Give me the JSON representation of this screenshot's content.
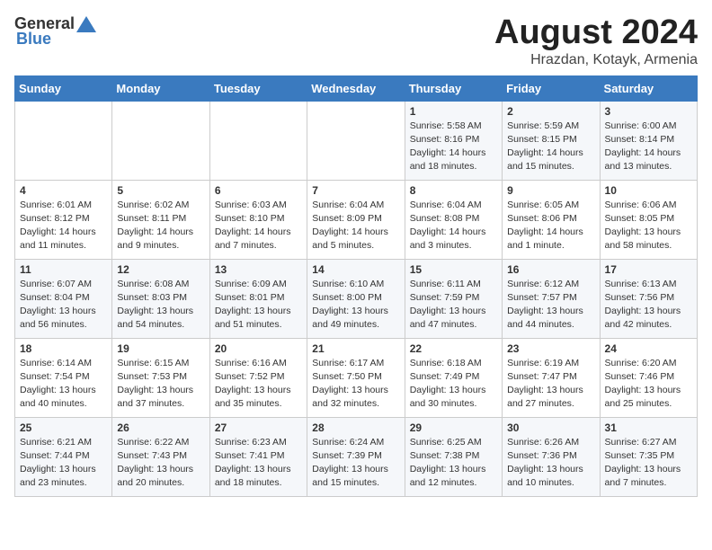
{
  "header": {
    "logo_general": "General",
    "logo_blue": "Blue",
    "month_year": "August 2024",
    "location": "Hrazdan, Kotayk, Armenia"
  },
  "weekdays": [
    "Sunday",
    "Monday",
    "Tuesday",
    "Wednesday",
    "Thursday",
    "Friday",
    "Saturday"
  ],
  "weeks": [
    [
      {
        "day": "",
        "info": ""
      },
      {
        "day": "",
        "info": ""
      },
      {
        "day": "",
        "info": ""
      },
      {
        "day": "",
        "info": ""
      },
      {
        "day": "1",
        "info": "Sunrise: 5:58 AM\nSunset: 8:16 PM\nDaylight: 14 hours\nand 18 minutes."
      },
      {
        "day": "2",
        "info": "Sunrise: 5:59 AM\nSunset: 8:15 PM\nDaylight: 14 hours\nand 15 minutes."
      },
      {
        "day": "3",
        "info": "Sunrise: 6:00 AM\nSunset: 8:14 PM\nDaylight: 14 hours\nand 13 minutes."
      }
    ],
    [
      {
        "day": "4",
        "info": "Sunrise: 6:01 AM\nSunset: 8:12 PM\nDaylight: 14 hours\nand 11 minutes."
      },
      {
        "day": "5",
        "info": "Sunrise: 6:02 AM\nSunset: 8:11 PM\nDaylight: 14 hours\nand 9 minutes."
      },
      {
        "day": "6",
        "info": "Sunrise: 6:03 AM\nSunset: 8:10 PM\nDaylight: 14 hours\nand 7 minutes."
      },
      {
        "day": "7",
        "info": "Sunrise: 6:04 AM\nSunset: 8:09 PM\nDaylight: 14 hours\nand 5 minutes."
      },
      {
        "day": "8",
        "info": "Sunrise: 6:04 AM\nSunset: 8:08 PM\nDaylight: 14 hours\nand 3 minutes."
      },
      {
        "day": "9",
        "info": "Sunrise: 6:05 AM\nSunset: 8:06 PM\nDaylight: 14 hours\nand 1 minute."
      },
      {
        "day": "10",
        "info": "Sunrise: 6:06 AM\nSunset: 8:05 PM\nDaylight: 13 hours\nand 58 minutes."
      }
    ],
    [
      {
        "day": "11",
        "info": "Sunrise: 6:07 AM\nSunset: 8:04 PM\nDaylight: 13 hours\nand 56 minutes."
      },
      {
        "day": "12",
        "info": "Sunrise: 6:08 AM\nSunset: 8:03 PM\nDaylight: 13 hours\nand 54 minutes."
      },
      {
        "day": "13",
        "info": "Sunrise: 6:09 AM\nSunset: 8:01 PM\nDaylight: 13 hours\nand 51 minutes."
      },
      {
        "day": "14",
        "info": "Sunrise: 6:10 AM\nSunset: 8:00 PM\nDaylight: 13 hours\nand 49 minutes."
      },
      {
        "day": "15",
        "info": "Sunrise: 6:11 AM\nSunset: 7:59 PM\nDaylight: 13 hours\nand 47 minutes."
      },
      {
        "day": "16",
        "info": "Sunrise: 6:12 AM\nSunset: 7:57 PM\nDaylight: 13 hours\nand 44 minutes."
      },
      {
        "day": "17",
        "info": "Sunrise: 6:13 AM\nSunset: 7:56 PM\nDaylight: 13 hours\nand 42 minutes."
      }
    ],
    [
      {
        "day": "18",
        "info": "Sunrise: 6:14 AM\nSunset: 7:54 PM\nDaylight: 13 hours\nand 40 minutes."
      },
      {
        "day": "19",
        "info": "Sunrise: 6:15 AM\nSunset: 7:53 PM\nDaylight: 13 hours\nand 37 minutes."
      },
      {
        "day": "20",
        "info": "Sunrise: 6:16 AM\nSunset: 7:52 PM\nDaylight: 13 hours\nand 35 minutes."
      },
      {
        "day": "21",
        "info": "Sunrise: 6:17 AM\nSunset: 7:50 PM\nDaylight: 13 hours\nand 32 minutes."
      },
      {
        "day": "22",
        "info": "Sunrise: 6:18 AM\nSunset: 7:49 PM\nDaylight: 13 hours\nand 30 minutes."
      },
      {
        "day": "23",
        "info": "Sunrise: 6:19 AM\nSunset: 7:47 PM\nDaylight: 13 hours\nand 27 minutes."
      },
      {
        "day": "24",
        "info": "Sunrise: 6:20 AM\nSunset: 7:46 PM\nDaylight: 13 hours\nand 25 minutes."
      }
    ],
    [
      {
        "day": "25",
        "info": "Sunrise: 6:21 AM\nSunset: 7:44 PM\nDaylight: 13 hours\nand 23 minutes."
      },
      {
        "day": "26",
        "info": "Sunrise: 6:22 AM\nSunset: 7:43 PM\nDaylight: 13 hours\nand 20 minutes."
      },
      {
        "day": "27",
        "info": "Sunrise: 6:23 AM\nSunset: 7:41 PM\nDaylight: 13 hours\nand 18 minutes."
      },
      {
        "day": "28",
        "info": "Sunrise: 6:24 AM\nSunset: 7:39 PM\nDaylight: 13 hours\nand 15 minutes."
      },
      {
        "day": "29",
        "info": "Sunrise: 6:25 AM\nSunset: 7:38 PM\nDaylight: 13 hours\nand 12 minutes."
      },
      {
        "day": "30",
        "info": "Sunrise: 6:26 AM\nSunset: 7:36 PM\nDaylight: 13 hours\nand 10 minutes."
      },
      {
        "day": "31",
        "info": "Sunrise: 6:27 AM\nSunset: 7:35 PM\nDaylight: 13 hours\nand 7 minutes."
      }
    ]
  ]
}
